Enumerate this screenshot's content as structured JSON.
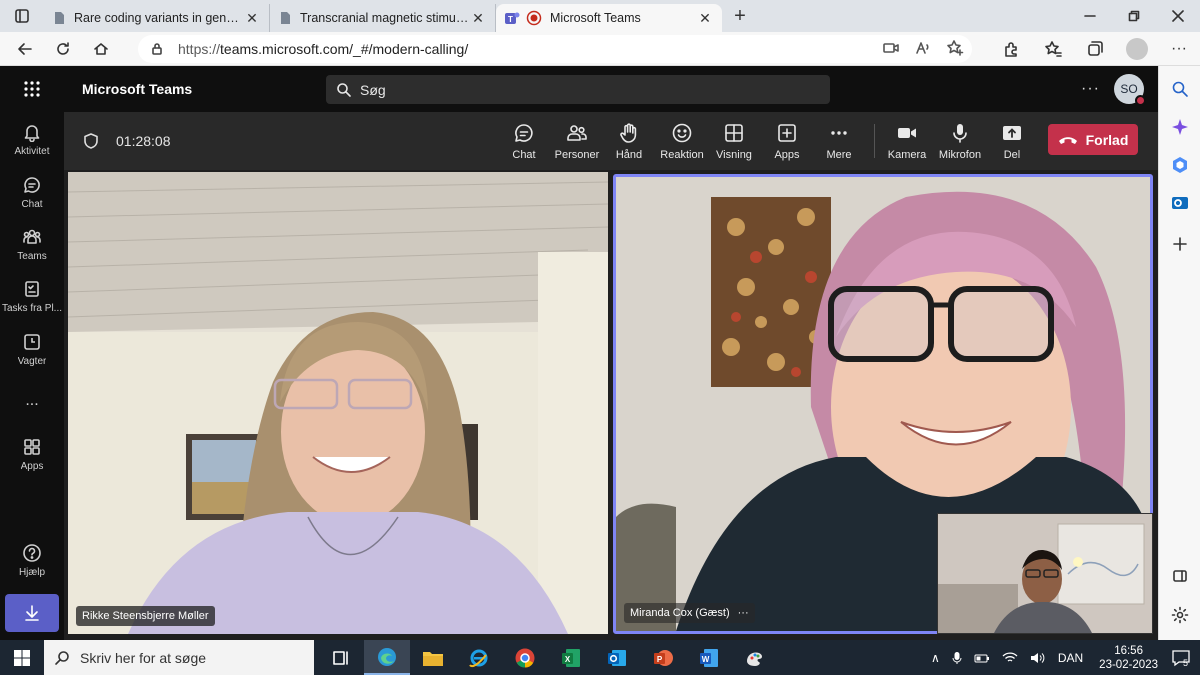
{
  "browser": {
    "tabs": [
      {
        "title": "Rare coding variants in genes en",
        "icon": "document-icon",
        "active": false
      },
      {
        "title": "Transcranial magnetic stimulation",
        "icon": "document-icon",
        "active": false
      },
      {
        "title": "Microsoft Teams",
        "icon": "teams-icon",
        "active": true
      }
    ],
    "url_prefix": "https://",
    "url": "teams.microsoft.com/_#/modern-calling/"
  },
  "teams": {
    "app_name": "Microsoft Teams",
    "search_placeholder": "Søg",
    "user_initials": "SO",
    "rail": [
      {
        "label": "Aktivitet",
        "icon": "bell-icon"
      },
      {
        "label": "Chat",
        "icon": "chat-icon"
      },
      {
        "label": "Teams",
        "icon": "teams-people-icon"
      },
      {
        "label": "Tasks fra Pl...",
        "icon": "tasks-icon"
      },
      {
        "label": "Vagter",
        "icon": "clock-icon"
      },
      {
        "label": "...",
        "icon": "more-icon"
      },
      {
        "label": "Apps",
        "icon": "apps-icon"
      },
      {
        "label": "Hjælp",
        "icon": "help-icon"
      }
    ],
    "meeting": {
      "timer": "01:28:08",
      "controls": [
        {
          "label": "Chat",
          "icon": "chat-icon"
        },
        {
          "label": "Personer",
          "icon": "people-icon"
        },
        {
          "label": "Hånd",
          "icon": "hand-icon"
        },
        {
          "label": "Reaktion",
          "icon": "smile-icon"
        },
        {
          "label": "Visning",
          "icon": "grid-icon"
        },
        {
          "label": "Apps",
          "icon": "plus-square-icon"
        },
        {
          "label": "Mere",
          "icon": "more-icon"
        },
        {
          "label": "Kamera",
          "icon": "camera-icon"
        },
        {
          "label": "Mikrofon",
          "icon": "mic-icon"
        },
        {
          "label": "Del",
          "icon": "share-icon"
        }
      ],
      "leave_label": "Forlad",
      "participants": [
        {
          "name": "Rikke Steensbjerre Møller"
        },
        {
          "name": "Miranda Cox (Gæst)",
          "more": "···"
        }
      ]
    }
  },
  "taskbar": {
    "search_placeholder": "Skriv her for at søge",
    "language": "DAN",
    "time": "16:56",
    "date": "23-02-2023",
    "notifications": "5"
  }
}
